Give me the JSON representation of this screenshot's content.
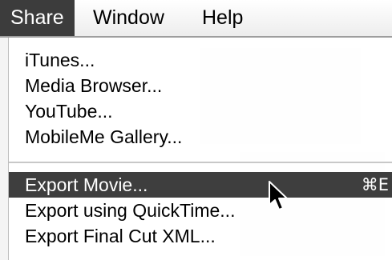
{
  "menubar": {
    "items": [
      {
        "label": "Share",
        "active": true
      },
      {
        "label": "Window",
        "active": false
      },
      {
        "label": "Help",
        "active": false
      }
    ]
  },
  "share_menu": {
    "group1": [
      {
        "label": "iTunes..."
      },
      {
        "label": "Media Browser..."
      },
      {
        "label": "YouTube..."
      },
      {
        "label": "MobileMe Gallery..."
      }
    ],
    "group2": [
      {
        "label": "Export Movie...",
        "shortcut": "⌘E",
        "highlighted": true
      },
      {
        "label": "Export using QuickTime...",
        "highlighted": false
      },
      {
        "label": "Export Final Cut XML...",
        "highlighted": false
      }
    ]
  },
  "colors": {
    "highlight": "#3e3e3e",
    "highlight_text": "#ffffff"
  },
  "icons": {
    "pointer": "arrow-cursor-icon"
  }
}
